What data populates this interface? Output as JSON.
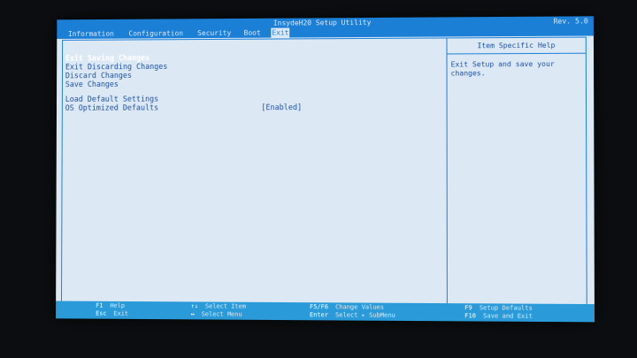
{
  "title_bar": {
    "title": "InsydeH20 Setup Utility",
    "revision": "Rev. 5.0"
  },
  "menu": {
    "tabs": [
      {
        "label": "Information"
      },
      {
        "label": "Configuration"
      },
      {
        "label": "Security"
      },
      {
        "label": "Boot"
      },
      {
        "label": "Exit"
      }
    ],
    "active_tab": "Exit"
  },
  "exit_options": [
    {
      "label": "Exit Saving Changes",
      "selected": true
    },
    {
      "label": "Exit Discarding Changes"
    },
    {
      "label": "Discard Changes"
    },
    {
      "label": "Save Changes"
    },
    {
      "label": "Load Default Settings"
    },
    {
      "label": "OS Optimized Defaults",
      "value": "[Enabled]"
    }
  ],
  "help_panel": {
    "heading": "Item Specific Help",
    "text": "Exit Setup and save your changes."
  },
  "footer": [
    {
      "key": "F1",
      "action": "Help"
    },
    {
      "key": "Esc",
      "action": "Exit"
    },
    {
      "key": "↑↓",
      "action": "Select Item"
    },
    {
      "key": "↔",
      "action": "Select Menu"
    },
    {
      "key": "F5/F6",
      "action": "Change Values"
    },
    {
      "key": "Enter",
      "action": "Select ▸ SubMenu"
    },
    {
      "key": "F9",
      "action": "Setup Defaults"
    },
    {
      "key": "F10",
      "action": "Save and Exit"
    }
  ],
  "colors": {
    "background": "#dce9f5",
    "accent": "#1c7fd6",
    "text": "#1c4f9e",
    "selected_text": "#ffffff",
    "footer": "#2a9bd8"
  }
}
